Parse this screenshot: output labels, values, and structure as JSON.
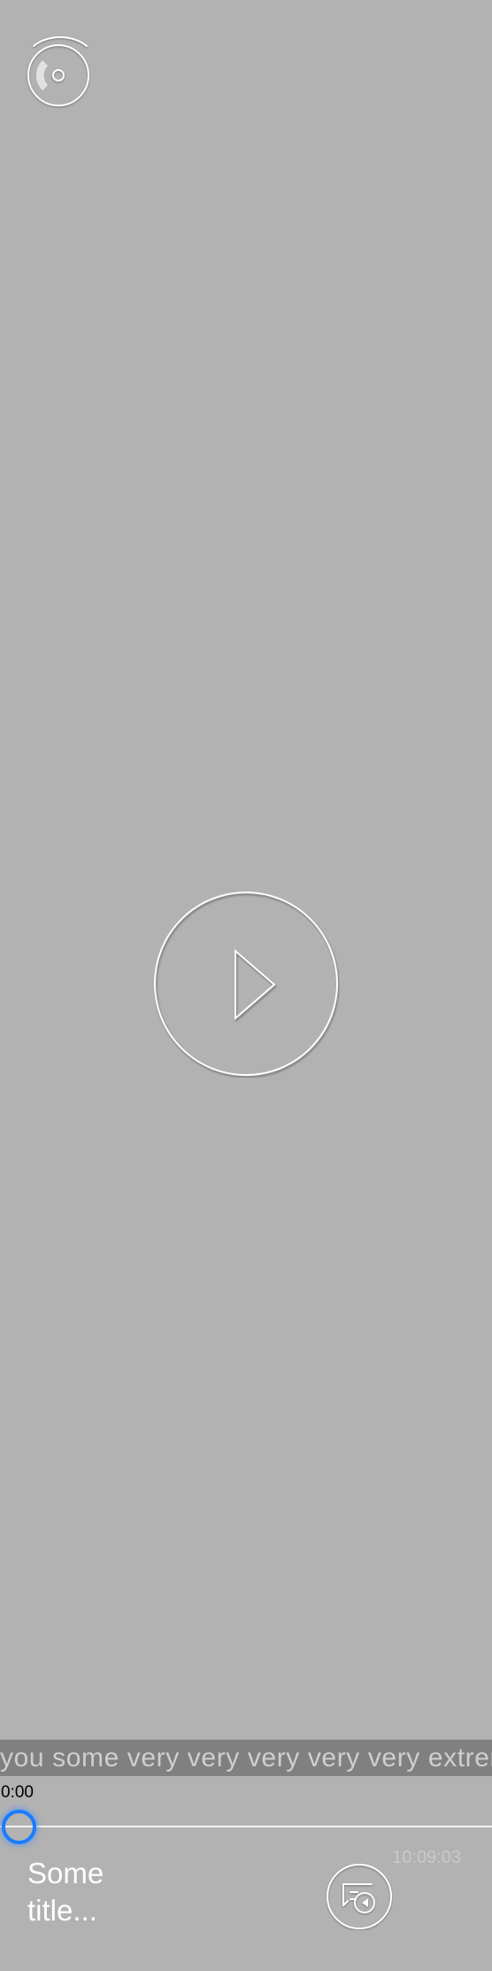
{
  "player": {
    "caption_marquee": "you some very very very very very extremely long caption text",
    "current_time": "0:00",
    "total_time": "10:09:03",
    "title": "Some title...",
    "progress_fraction": 0
  },
  "icons": {
    "cast": "cast-disc-icon",
    "play": "play-icon",
    "playlist": "playlist-play-icon"
  },
  "colors": {
    "background": "#b2b2b2",
    "caption_bar": "#808080",
    "progress_thumb": "#1a7bff",
    "track": "#f4f4f4"
  }
}
